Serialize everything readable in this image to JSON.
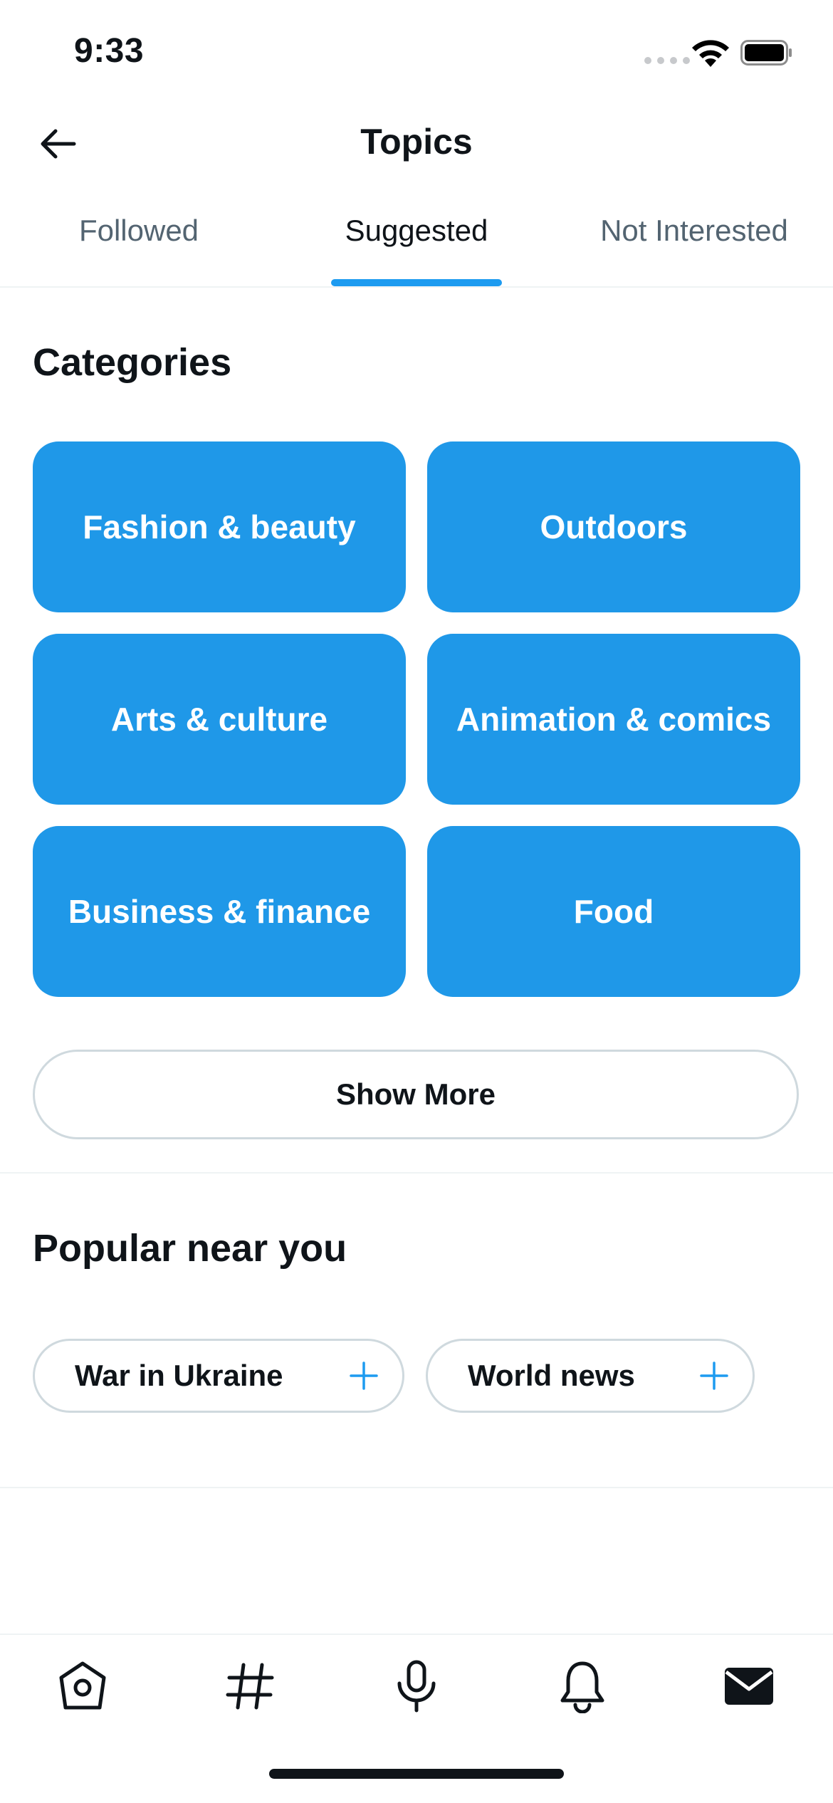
{
  "status_bar": {
    "time": "9:33"
  },
  "header": {
    "title": "Topics"
  },
  "tabs": [
    {
      "label": "Followed",
      "active": false
    },
    {
      "label": "Suggested",
      "active": true
    },
    {
      "label": "Not Interested",
      "active": false
    }
  ],
  "categories": {
    "title": "Categories",
    "items": [
      {
        "label": "Fashion & beauty"
      },
      {
        "label": "Outdoors"
      },
      {
        "label": "Arts & culture"
      },
      {
        "label": "Animation & comics"
      },
      {
        "label": "Business & finance"
      },
      {
        "label": "Food"
      }
    ],
    "show_more_label": "Show More"
  },
  "popular": {
    "title": "Popular near you",
    "items": [
      {
        "label": "War in Ukraine",
        "icon": "plus-icon"
      },
      {
        "label": "World news",
        "icon": "plus-icon"
      }
    ]
  },
  "bottom_nav": [
    {
      "icon": "home-icon"
    },
    {
      "icon": "hashtag-icon"
    },
    {
      "icon": "microphone-icon"
    },
    {
      "icon": "bell-icon"
    },
    {
      "icon": "mail-icon",
      "active": true
    }
  ],
  "colors": {
    "accent": "#1d9bf0",
    "category_tile": "#1f98e8",
    "text_primary": "#0f1419",
    "text_secondary": "#536471",
    "border": "#cfd9de"
  }
}
